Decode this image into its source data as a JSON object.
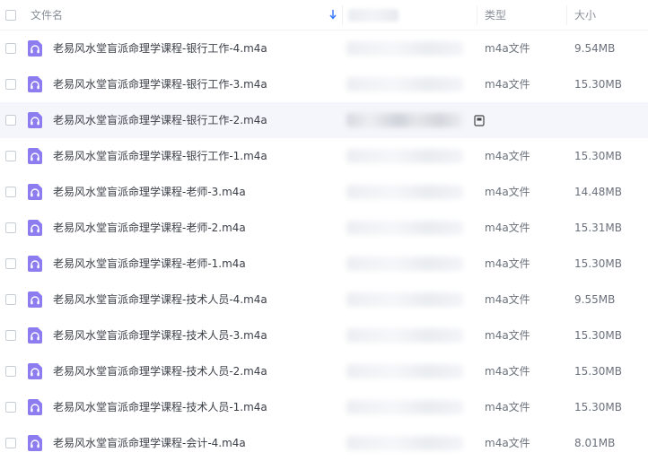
{
  "header": {
    "name_label": "文件名",
    "type_label": "类型",
    "size_label": "大小"
  },
  "colors": {
    "icon_purple": "#8b7cf0",
    "sort_arrow": "#3d7cff",
    "hover_row": "#f5f6fb"
  },
  "icons": {
    "file": "headphones-icon",
    "sort": "sort-down-arrow-icon",
    "hover_action": "copy-icon"
  },
  "files": [
    {
      "name": "老易风水堂盲派命理学课程-银行工作-4.m4a",
      "type": "m4a文件",
      "size": "9.54MB"
    },
    {
      "name": "老易风水堂盲派命理学课程-银行工作-3.m4a",
      "type": "m4a文件",
      "size": "15.30MB"
    },
    {
      "name": "老易风水堂盲派命理学课程-银行工作-2.m4a",
      "type": "",
      "size": "",
      "hover": true
    },
    {
      "name": "老易风水堂盲派命理学课程-银行工作-1.m4a",
      "type": "m4a文件",
      "size": "15.30MB"
    },
    {
      "name": "老易风水堂盲派命理学课程-老师-3.m4a",
      "type": "m4a文件",
      "size": "14.48MB"
    },
    {
      "name": "老易风水堂盲派命理学课程-老师-2.m4a",
      "type": "m4a文件",
      "size": "15.31MB"
    },
    {
      "name": "老易风水堂盲派命理学课程-老师-1.m4a",
      "type": "m4a文件",
      "size": "15.30MB"
    },
    {
      "name": "老易风水堂盲派命理学课程-技术人员-4.m4a",
      "type": "m4a文件",
      "size": "9.55MB"
    },
    {
      "name": "老易风水堂盲派命理学课程-技术人员-3.m4a",
      "type": "m4a文件",
      "size": "15.30MB"
    },
    {
      "name": "老易风水堂盲派命理学课程-技术人员-2.m4a",
      "type": "m4a文件",
      "size": "15.30MB"
    },
    {
      "name": "老易风水堂盲派命理学课程-技术人员-1.m4a",
      "type": "m4a文件",
      "size": "15.30MB"
    },
    {
      "name": "老易风水堂盲派命理学课程-会计-4.m4a",
      "type": "m4a文件",
      "size": "8.01MB"
    }
  ]
}
